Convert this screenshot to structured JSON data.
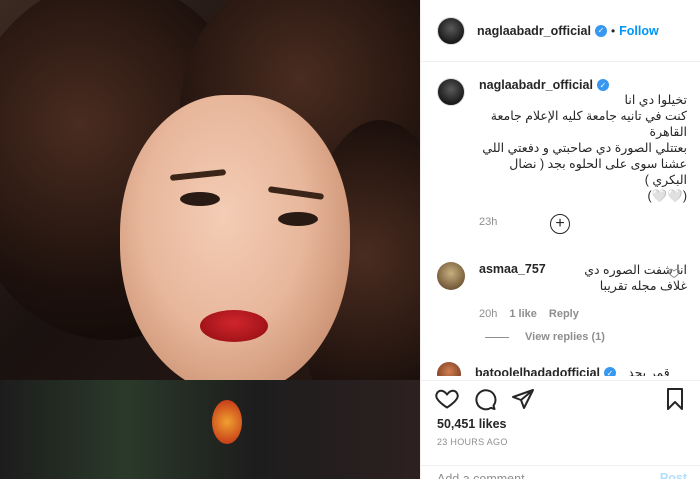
{
  "post": {
    "username": "naglaabadr_official",
    "follow_label": "Follow",
    "dot": "•",
    "caption": "تخيلوا دي انا\nكنت في تانيه جامعة كليه الإعلام جامعة القاهرة\nبعتتلي الصورة دي صاحبتي و دفعتي اللي عشنا سوى على الحلوه بجد ( نضال البكري )\n(🤍🤍)",
    "caption_time": "23h",
    "likes": "50,451 likes",
    "posted": "23 HOURS AGO",
    "add_comment_placeholder": "Add a comment...",
    "post_label": "Post",
    "more_symbol": "+"
  },
  "comments": [
    {
      "username": "asmaa_757",
      "text": "انا شفت الصوره دي\nغلاف مجله تقريبا",
      "time": "20h",
      "likes": "1 like",
      "reply": "Reply",
      "view_replies": "View replies (1)"
    },
    {
      "username": "batoolelhadadofficial",
      "text": "قمر بجد"
    }
  ],
  "icons": [
    "heart-icon",
    "comment-icon",
    "share-icon",
    "bookmark-icon",
    "verified-icon"
  ],
  "colors": {
    "accent": "#0095f6",
    "verified": "#3897f0",
    "muted": "#8e8e8e"
  }
}
